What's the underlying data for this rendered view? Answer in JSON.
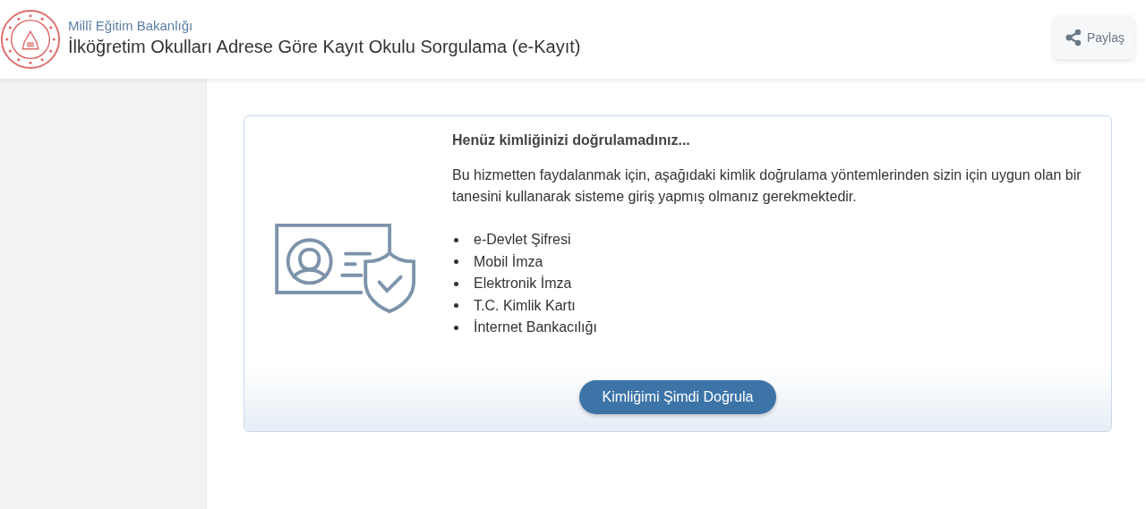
{
  "header": {
    "ministry": "Millî Eğitim Bakanlığı",
    "title": "İlköğretim Okulları Adrese Göre Kayıt Okulu Sorgulama (e-Kayıt)",
    "share_button": "Paylaş"
  },
  "notice": {
    "heading": "Henüz kimliğinizi doğrulamadınız...",
    "message": "Bu hizmetten faydalanmak için, aşağıdaki kimlik doğrulama yöntemlerinden sizin için uygun olan bir tanesini kullanarak sisteme giriş yapmış olmanız gerekmektedir.",
    "methods": [
      "e-Devlet Şifresi",
      "Mobil İmza",
      "Elektronik İmza",
      "T.C. Kimlik Kartı",
      "İnternet Bankacılığı"
    ],
    "button": "Kimliğimi Şimdi Doğrula"
  }
}
